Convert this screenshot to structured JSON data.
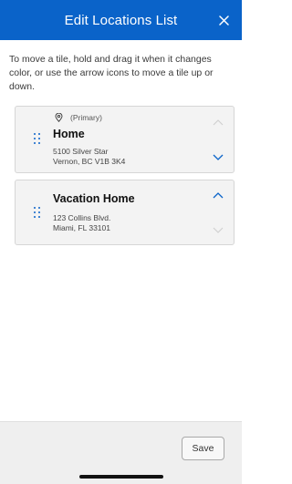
{
  "header": {
    "title": "Edit Locations List",
    "close_icon": "close-icon",
    "background": "#0a63c9"
  },
  "instructions": "To move a tile, hold and drag it when it changes color, or use the arrow icons to move a tile up or down.",
  "locations": [
    {
      "primary_label": "(Primary)",
      "name": "Home",
      "address_line1": "5100 Silver Star",
      "address_line2": "Vernon, BC V1B 3K4",
      "up_enabled": false,
      "down_enabled": true
    },
    {
      "name": "Vacation Home",
      "address_line1": "123 Collins Blvd.",
      "address_line2": "Miami, FL 33101",
      "up_enabled": true,
      "down_enabled": false
    }
  ],
  "footer": {
    "save_label": "Save"
  },
  "colors": {
    "accent": "#0a63c9",
    "disabled_arrow": "#c9c9c9"
  }
}
